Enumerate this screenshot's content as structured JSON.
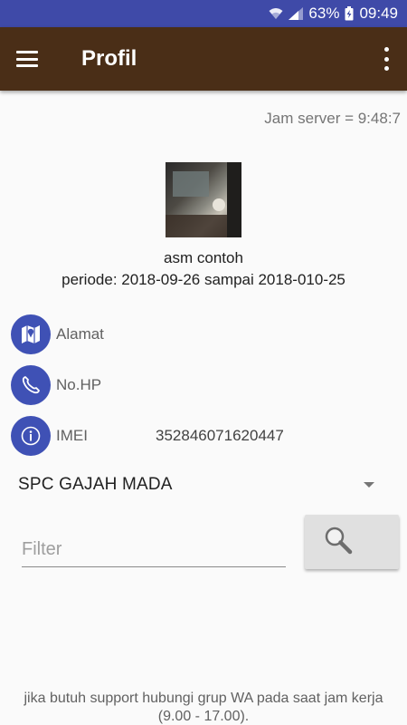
{
  "status_bar": {
    "battery": "63%",
    "time": "09:49",
    "icons": [
      "wifi-icon",
      "signal-icon",
      "battery-charging-icon"
    ]
  },
  "app_bar": {
    "title": "Profil",
    "menu_icon": "hamburger-menu-icon",
    "overflow_icon": "more-vert-icon"
  },
  "server_time": "Jam server = 9:48:7",
  "profile": {
    "name": "asm contoh",
    "periode": "periode: 2018-09-26 sampai 2018-010-25"
  },
  "info": {
    "address_label": "Alamat",
    "phone_label": "No.HP",
    "imei_label": "IMEI",
    "imei_value": "352846071620447"
  },
  "spinner": {
    "selected": "SPC GAJAH MADA"
  },
  "filter": {
    "placeholder": "Filter",
    "value": ""
  },
  "footer": {
    "line1": "jika butuh support hubungi grup WA pada saat jam kerja",
    "line2": "(9.00 - 17.00)."
  },
  "colors": {
    "status_bar": "#3f4aa8",
    "app_bar": "#4a2e17",
    "icon_circle": "#3f51b5"
  }
}
